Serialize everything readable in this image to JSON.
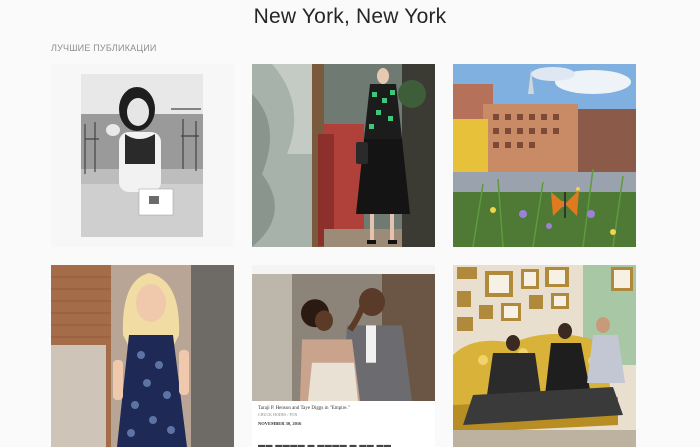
{
  "header": {
    "location_title": "New York, New York"
  },
  "section": {
    "top_posts_label": "ЛУЧШИЕ ПУБЛИКАЦИИ"
  },
  "posts": [
    {
      "kind": "bw-photo-woman-cafe"
    },
    {
      "kind": "fashion-model-leather-skirt"
    },
    {
      "kind": "city-rooftop-butterfly"
    },
    {
      "kind": "blonde-woman-lace-dress"
    },
    {
      "kind": "magazine-clipping-couple",
      "caption": "Taraji P. Henson and Taye Diggs in \"Empire.\"",
      "credit": "CHUCK HODES / FOX",
      "date": "NOVEMBER 30, 2016"
    },
    {
      "kind": "group-gold-sofa"
    }
  ],
  "colors": {
    "background": "#fafafa",
    "title_text": "#262626",
    "label_text": "#8e8e8e"
  }
}
